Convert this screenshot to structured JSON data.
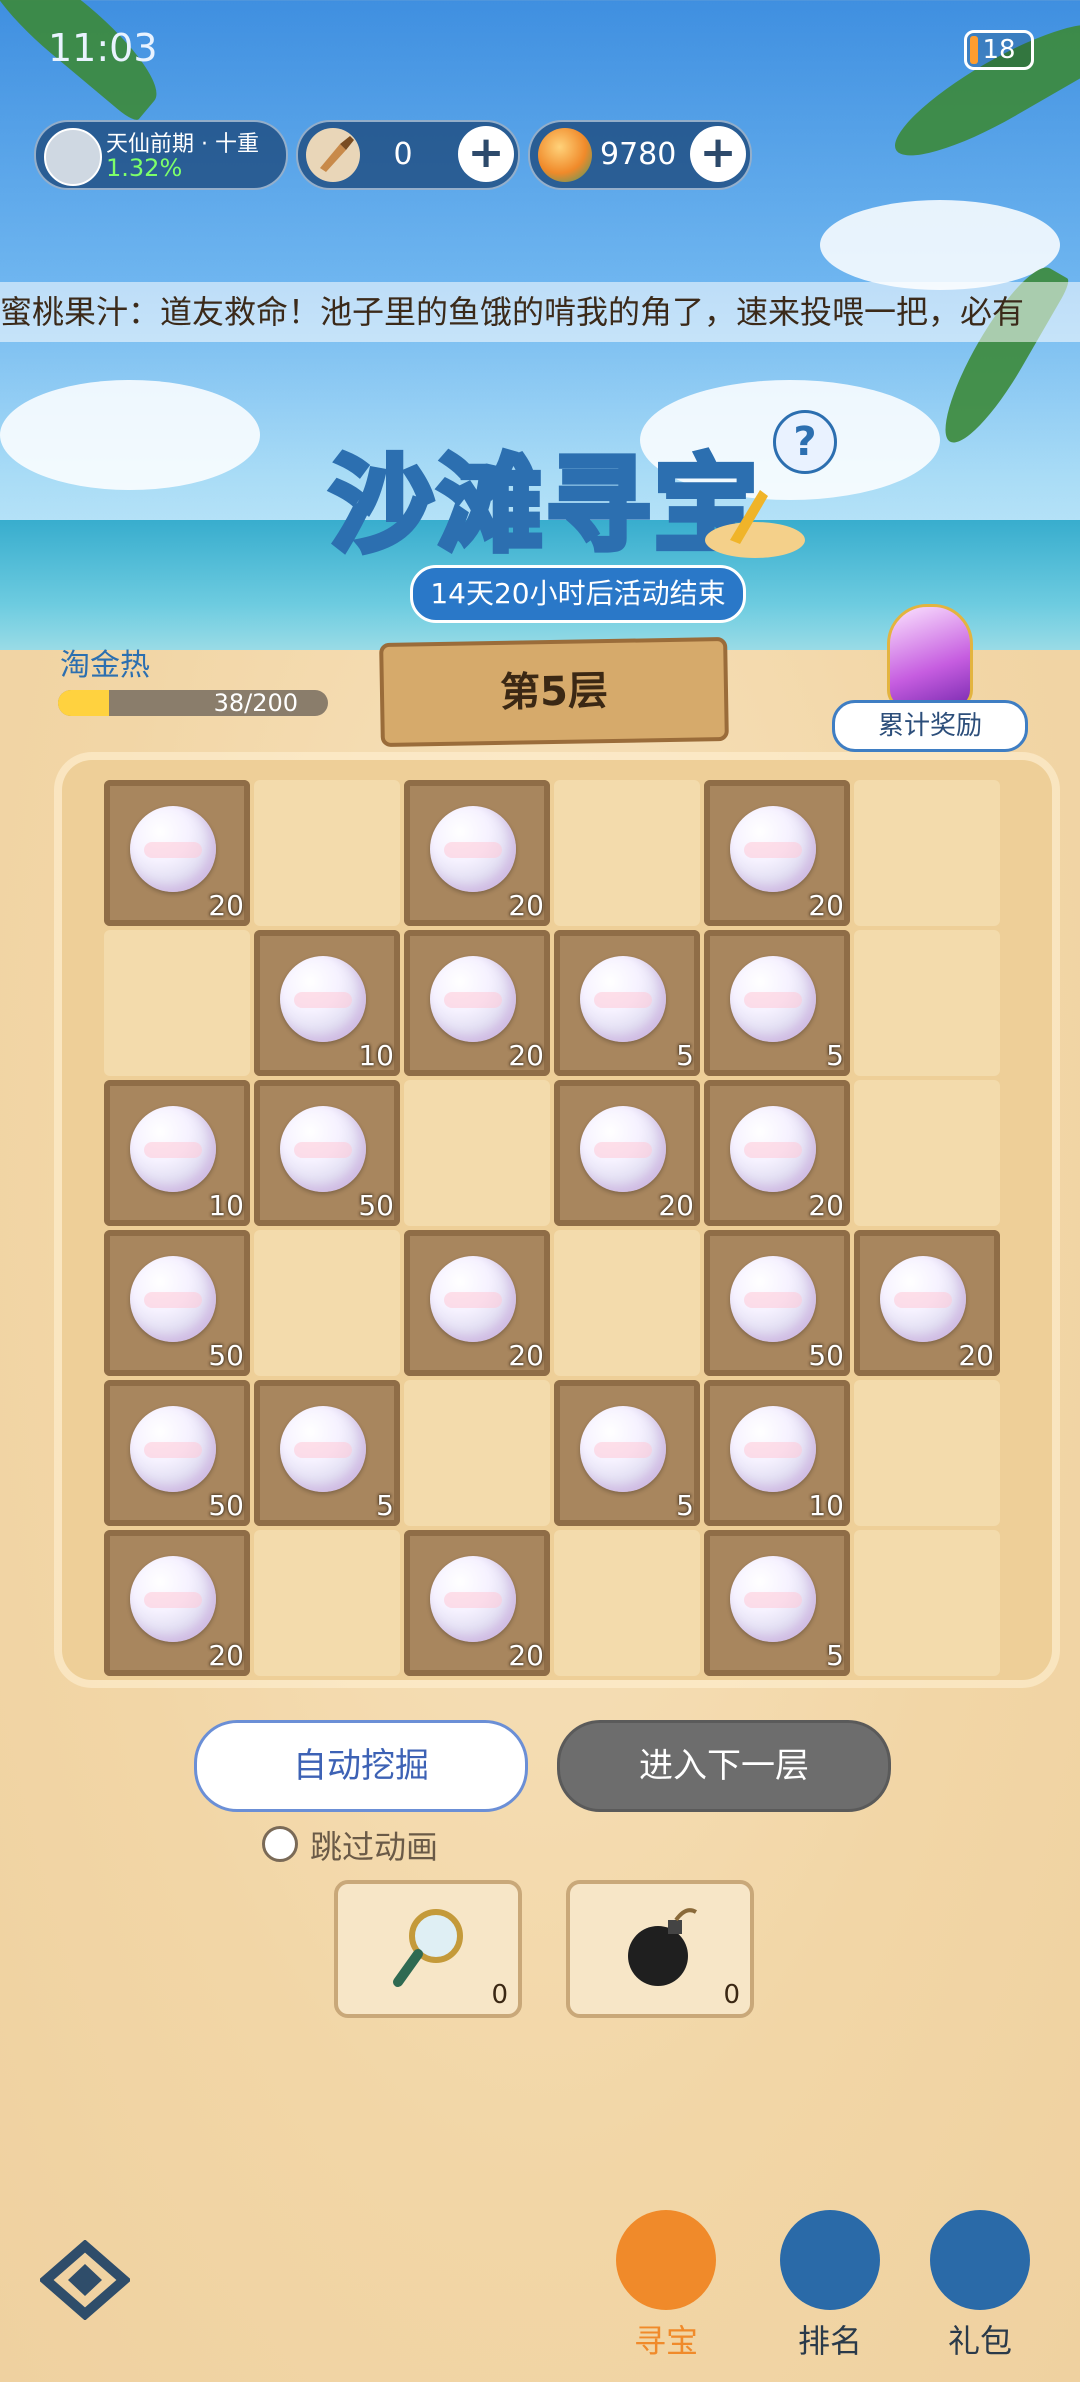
{
  "status": {
    "time": "11:03",
    "battery": "18"
  },
  "top_bar": {
    "rank": {
      "name": "天仙前期 · 十重",
      "percent": "1.32%"
    },
    "shovel": {
      "value": "0",
      "plus": "+"
    },
    "gem": {
      "value": "9780",
      "plus": "+"
    }
  },
  "marquee": {
    "text": "蜜桃果汁：道友救命！池子里的鱼饿的啃我的角了，速来投喂一把，必有"
  },
  "event": {
    "title": "沙滩寻宝",
    "subtitle": "14天20小时后活动结束",
    "help": "?"
  },
  "heat": {
    "label": "淘金热",
    "value": "38/200",
    "progress": 0.19
  },
  "level": {
    "label": "第5层"
  },
  "reward": {
    "label": "累计奖励"
  },
  "grid": {
    "rows": [
      [
        {
          "dug": true,
          "count": "20"
        },
        {
          "dug": false
        },
        {
          "dug": true,
          "count": "20"
        },
        {
          "dug": false
        },
        {
          "dug": true,
          "count": "20"
        },
        {
          "dug": false
        }
      ],
      [
        {
          "dug": false
        },
        {
          "dug": true,
          "count": "10"
        },
        {
          "dug": true,
          "count": "20"
        },
        {
          "dug": true,
          "count": "5"
        },
        {
          "dug": true,
          "count": "5"
        },
        {
          "dug": false
        }
      ],
      [
        {
          "dug": true,
          "count": "10"
        },
        {
          "dug": true,
          "count": "50"
        },
        {
          "dug": false
        },
        {
          "dug": true,
          "count": "20"
        },
        {
          "dug": true,
          "count": "20"
        },
        {
          "dug": false
        }
      ],
      [
        {
          "dug": true,
          "count": "50"
        },
        {
          "dug": false
        },
        {
          "dug": true,
          "count": "20"
        },
        {
          "dug": false
        },
        {
          "dug": true,
          "count": "50"
        },
        {
          "dug": true,
          "count": "20"
        }
      ],
      [
        {
          "dug": true,
          "count": "50"
        },
        {
          "dug": true,
          "count": "5"
        },
        {
          "dug": false
        },
        {
          "dug": true,
          "count": "5"
        },
        {
          "dug": true,
          "count": "10"
        },
        {
          "dug": false
        }
      ],
      [
        {
          "dug": true,
          "count": "20"
        },
        {
          "dug": false
        },
        {
          "dug": true,
          "count": "20"
        },
        {
          "dug": false
        },
        {
          "dug": true,
          "count": "5"
        },
        {
          "dug": false
        }
      ]
    ]
  },
  "actions": {
    "auto_dig": "自动挖掘",
    "next_level": "进入下一层",
    "skip_animation": "跳过动画"
  },
  "tools": [
    {
      "name": "magnifier-icon",
      "count": "0"
    },
    {
      "name": "bomb-icon",
      "count": "0"
    }
  ],
  "nav": [
    {
      "label": "寻宝",
      "active": true,
      "color": "#f08a2a"
    },
    {
      "label": "排名",
      "active": false,
      "color": "#2a6aa8"
    },
    {
      "label": "礼包",
      "active": false,
      "color": "#2a6aa8"
    }
  ]
}
